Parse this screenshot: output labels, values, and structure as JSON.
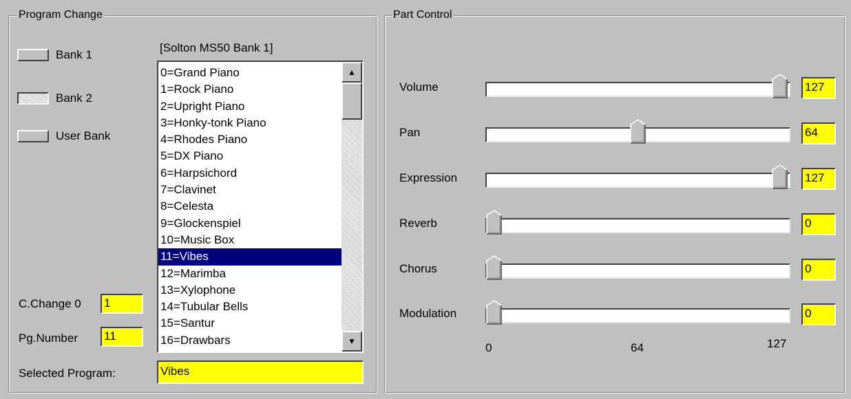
{
  "program_change": {
    "title": "Program Change",
    "banks": [
      {
        "label": "Bank 1",
        "pressed": false
      },
      {
        "label": "Bank 2",
        "pressed": true
      },
      {
        "label": "User Bank",
        "pressed": false
      }
    ],
    "bank_name": "[Solton MS50 Bank 1]",
    "programs": [
      "0=Grand Piano",
      "1=Rock Piano",
      "2=Upright Piano",
      "3=Honky-tonk Piano",
      "4=Rhodes Piano",
      "5=DX Piano",
      "6=Harpsichord",
      "7=Clavinet",
      "8=Celesta",
      "9=Glockenspiel",
      "10=Music Box",
      "11=Vibes",
      "12=Marimba",
      "13=Xylophone",
      "14=Tubular Bells",
      "15=Santur",
      "16=Drawbars"
    ],
    "selected_index": 11,
    "cchange_label": "C.Change 0",
    "cchange_value": "1",
    "pgnumber_label": "Pg.Number",
    "pgnumber_value": "11",
    "selected_program_label": "Selected Program:",
    "selected_program_value": "Vibes",
    "scroll_up_icon": "arrow-up-icon",
    "scroll_down_icon": "arrow-down-icon"
  },
  "part_control": {
    "title": "Part Control",
    "max": 127,
    "sliders": [
      {
        "label": "Volume",
        "value": "127"
      },
      {
        "label": "Pan",
        "value": "64"
      },
      {
        "label": "Expression",
        "value": "127"
      },
      {
        "label": "Reverb",
        "value": "0"
      },
      {
        "label": "Chorus",
        "value": "0"
      },
      {
        "label": "Modulation",
        "value": "0"
      }
    ],
    "scale": [
      "0",
      "64",
      "127"
    ]
  },
  "colors": {
    "face": "#c0c0c0",
    "highlight_value": "#ffff00",
    "selection": "#000080"
  }
}
